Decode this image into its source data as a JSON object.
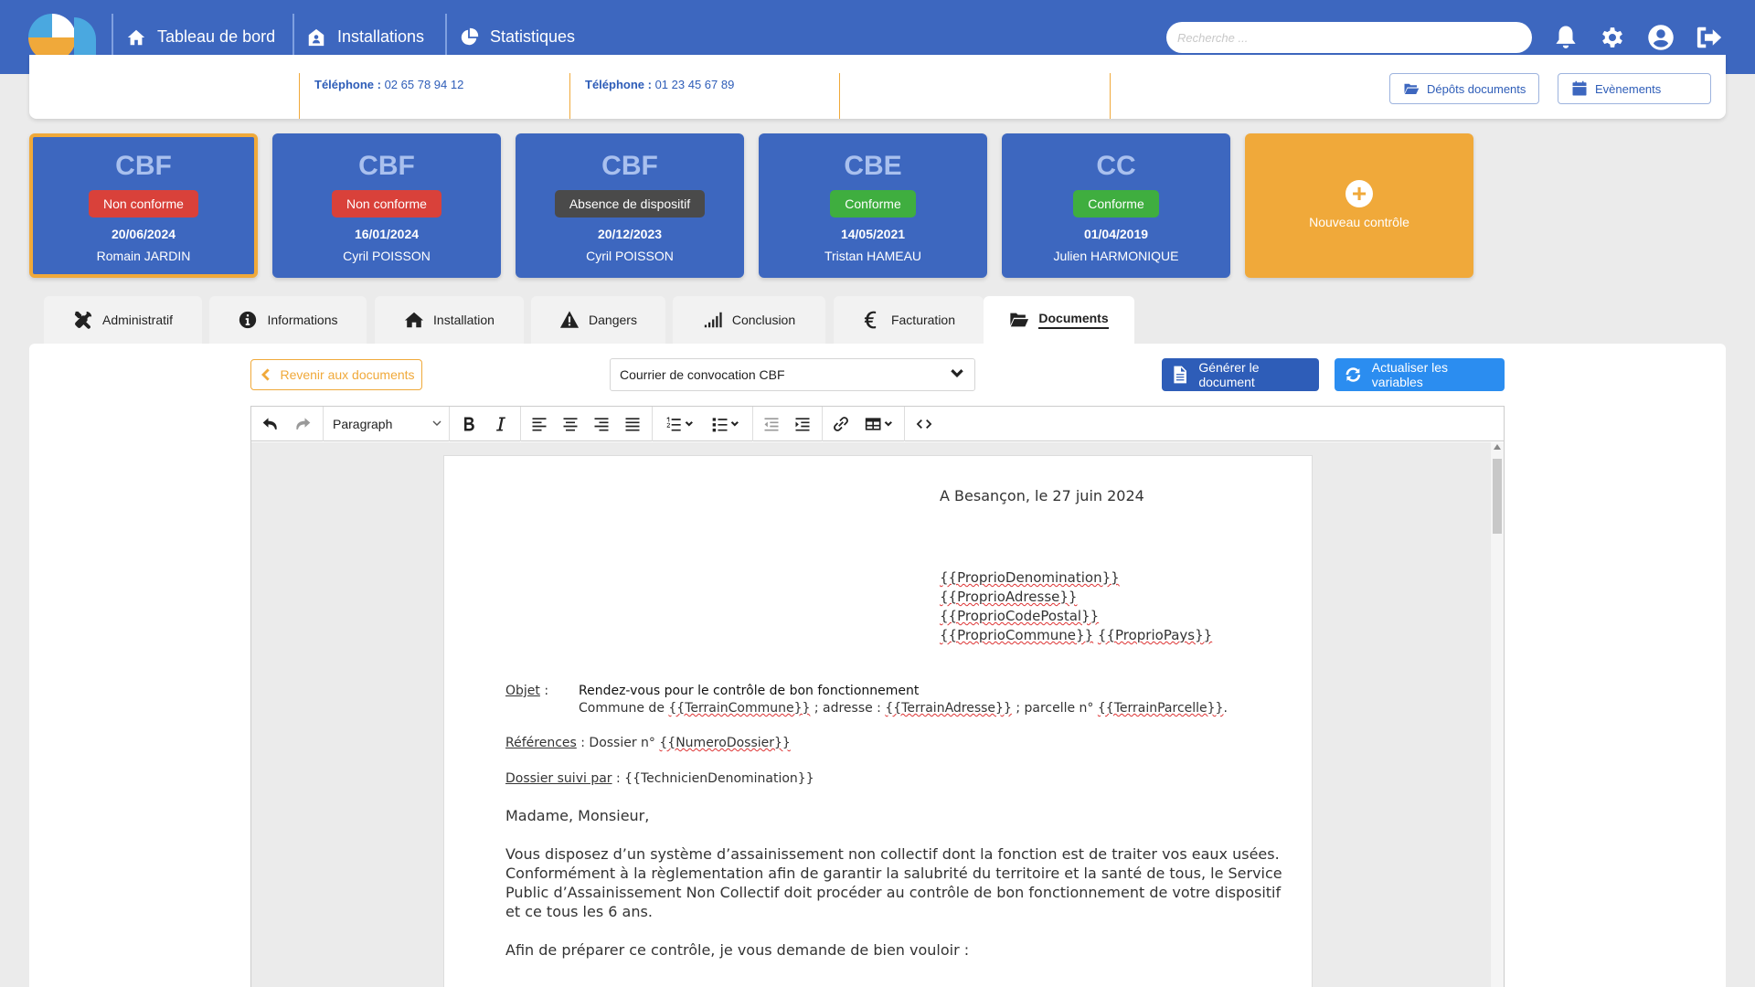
{
  "nav": {
    "items": [
      {
        "label": "Tableau de bord",
        "icon": "home-icon"
      },
      {
        "label": "Installations",
        "icon": "house-user-icon"
      },
      {
        "label": "Statistiques",
        "icon": "pie-chart-icon"
      }
    ],
    "search_placeholder": "Recherche ...",
    "icons": [
      "bell-icon",
      "gear-icon",
      "user-circle-icon",
      "logout-icon"
    ]
  },
  "info": {
    "tel1": {
      "label": "Téléphone :",
      "value": "02 65 78 94 12"
    },
    "tel2": {
      "label": "Téléphone :",
      "value": "01 23 45 67 89"
    },
    "btn_depots": "Dépôts documents",
    "btn_events": "Evènements"
  },
  "controls": [
    {
      "code": "CBF",
      "status": "Non conforme",
      "status_color": "#d9413a",
      "date": "20/06/2024",
      "technician": "Romain JARDIN",
      "selected": true
    },
    {
      "code": "CBF",
      "status": "Non conforme",
      "status_color": "#d9413a",
      "date": "16/01/2024",
      "technician": "Cyril POISSON",
      "selected": false
    },
    {
      "code": "CBF",
      "status": "Absence de dispositif",
      "status_color": "#4a4a4a",
      "date": "20/12/2023",
      "technician": "Cyril POISSON",
      "selected": false
    },
    {
      "code": "CBE",
      "status": "Conforme",
      "status_color": "#3fae3f",
      "date": "14/05/2021",
      "technician": "Tristan HAMEAU",
      "selected": false
    },
    {
      "code": "CC",
      "status": "Conforme",
      "status_color": "#3fae3f",
      "date": "01/04/2019",
      "technician": "Julien HARMONIQUE",
      "selected": false
    }
  ],
  "new_control_label": "Nouveau contrôle",
  "tabs": [
    {
      "label": "Administratif",
      "icon": "tools-icon"
    },
    {
      "label": "Informations",
      "icon": "info-circle-icon"
    },
    {
      "label": "Installation",
      "icon": "home-icon"
    },
    {
      "label": "Dangers",
      "icon": "warning-icon"
    },
    {
      "label": "Conclusion",
      "icon": "signal-bars-icon"
    },
    {
      "label": "Facturation",
      "icon": "euro-icon"
    },
    {
      "label": "Documents",
      "icon": "folder-open-icon",
      "active": true
    }
  ],
  "actions": {
    "back": "Revenir aux documents",
    "template_select": "Courrier de convocation CBF",
    "generate": "Générer le document",
    "refresh": "Actualiser les variables"
  },
  "toolbar": {
    "block_format": "Paragraph"
  },
  "letter": {
    "place_date": "A Besançon, le 27 juin 2024",
    "recipient": [
      "{{ProprioDenomination}}",
      "{{ProprioAdresse}}",
      "{{ProprioCodePostal}}"
    ],
    "recipient_commune": "{{ProprioCommune}}",
    "recipient_pays": "{{ProprioPays}}",
    "objet_label": "Objet",
    "objet_sep": " :",
    "objet_title": "Rendez-vous pour le contrôle de bon fonctionnement",
    "objet_line2": {
      "commune_prefix": "Commune de ",
      "commune_var": "{{TerrainCommune}}",
      "adresse_prefix": " ; adresse : ",
      "adresse_var": "{{TerrainAdresse}}",
      "parcelle_prefix": " ; parcelle n° ",
      "parcelle_var": "{{TerrainParcelle}}",
      "end": "."
    },
    "refs_label": "Références",
    "refs_prefix": " : Dossier n° ",
    "refs_var": "{{NumeroDossier}}",
    "suivi_label": "Dossier suivi par",
    "suivi_value": " : {{TechnicienDenomination}}",
    "salutation": "Madame, Monsieur,",
    "body": [
      "Vous disposez d’un système d’assainissement non collectif dont la fonction est de traiter vos eaux usées.",
      "Conformément à la règlementation afin de garantir la salubrité du territoire et la santé de tous, le Service",
      "Public d’Assainissement Non Collectif doit procéder au contrôle de bon fonctionnement de votre dispositif",
      "et ce tous les 6 ans."
    ],
    "closing": "Afin de préparer ce contrôle, je vous demande de bien vouloir :"
  }
}
